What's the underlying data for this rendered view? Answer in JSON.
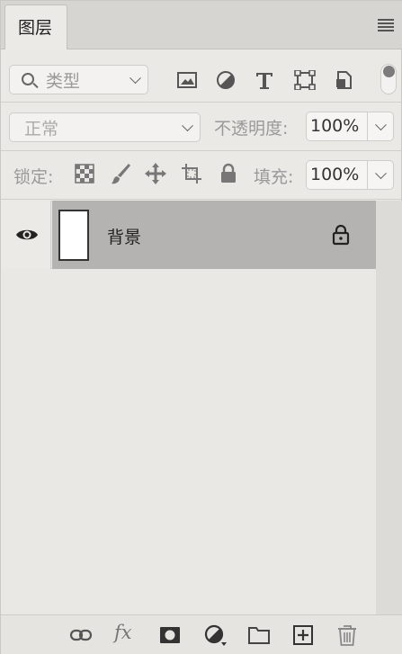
{
  "panel": {
    "tab_label": "图层",
    "menu_icon": "panel-menu-icon"
  },
  "filter": {
    "type_label": "类型",
    "icons": [
      "image-filter-icon",
      "adjustment-filter-icon",
      "type-filter-icon",
      "shape-filter-icon",
      "smart-object-filter-icon"
    ]
  },
  "blend": {
    "mode": "正常",
    "opacity_label": "不透明度:",
    "opacity_value": "100%"
  },
  "lock": {
    "label": "锁定:",
    "icons": [
      "lock-transparent-icon",
      "lock-image-icon",
      "lock-position-icon",
      "lock-artboard-icon",
      "lock-all-icon"
    ],
    "fill_label": "填充:",
    "fill_value": "100%"
  },
  "layers": [
    {
      "name": "背景",
      "visible": true,
      "locked": true
    }
  ],
  "bottom_bar": {
    "icons": [
      "link-layers-icon",
      "fx-icon",
      "add-mask-icon",
      "adjustment-layer-icon",
      "new-group-icon",
      "new-layer-icon",
      "delete-layer-icon"
    ],
    "fx_label": "fx"
  }
}
